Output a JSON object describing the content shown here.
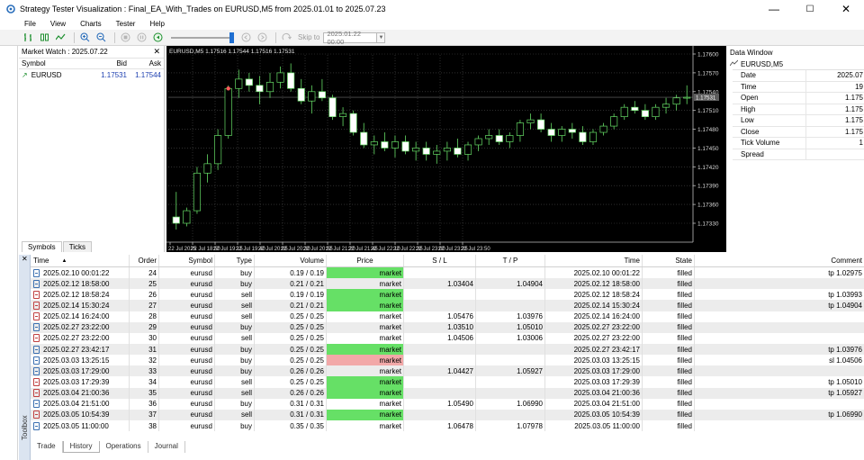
{
  "window": {
    "title": "Strategy Tester Visualization : Final_EA_With_Trades on EURUSD,M5 from 2025.01.01 to 2025.07.23",
    "minimize": "—",
    "maximize": "☐",
    "close": "✕"
  },
  "menu": [
    "File",
    "View",
    "Charts",
    "Tester",
    "Help"
  ],
  "toolbar": {
    "skip_label": "Skip to",
    "skip_date": "2025.01.22 00:00",
    "slider_position": 1.0
  },
  "market_watch": {
    "title": "Market Watch : 2025.07.22",
    "columns": [
      "Symbol",
      "Bid",
      "Ask"
    ],
    "rows": [
      {
        "symbol": "EURUSD",
        "bid": "1.17531",
        "ask": "1.17544"
      }
    ],
    "tabs": [
      "Symbols",
      "Ticks"
    ]
  },
  "chart": {
    "header": "EURUSD,M5  1.17516 1.17544 1.17516 1.17531",
    "price_labels": [
      "1.17600",
      "1.17570",
      "1.17540",
      "1.17510",
      "1.17480",
      "1.17450",
      "1.17420",
      "1.17390",
      "1.17360",
      "1.17330"
    ],
    "current_price_tag": "1.17531",
    "time_labels": [
      "22 Jul 2025",
      "22 Jul 18:50",
      "22 Jul 19:15",
      "22 Jul 19:40",
      "22 Jul 20:05",
      "22 Jul 20:30",
      "22 Jul 20:55",
      "22 Jul 21:20",
      "22 Jul 21:45",
      "22 Jul 22:10",
      "22 Jul 22:35",
      "22 Jul 23:00",
      "22 Jul 23:25",
      "22 Jul 23:50"
    ]
  },
  "data_window": {
    "title": "Data Window",
    "symbol": "EURUSD,M5",
    "rows": [
      {
        "label": "Date",
        "value": "2025.07"
      },
      {
        "label": "Time",
        "value": "19"
      },
      {
        "label": "Open",
        "value": "1.175"
      },
      {
        "label": "High",
        "value": "1.175"
      },
      {
        "label": "Low",
        "value": "1.175"
      },
      {
        "label": "Close",
        "value": "1.175"
      },
      {
        "label": "Tick Volume",
        "value": "1"
      },
      {
        "label": "Spread",
        "value": ""
      }
    ]
  },
  "toolbox": {
    "label": "Toolbox",
    "close": "✕"
  },
  "orders": {
    "columns": [
      "Time",
      "Order",
      "Symbol",
      "Type",
      "Volume",
      "Price",
      "S / L",
      "T / P",
      "Time",
      "State",
      "Comment"
    ],
    "sort_indicator": "▲",
    "rows": [
      {
        "time": "2025.02.10 00:01:22",
        "order": "24",
        "symbol": "eurusd",
        "type": "buy",
        "volume": "0.19 / 0.19",
        "price": "market",
        "price_bg": "green",
        "sl": "",
        "tp": "",
        "time2": "2025.02.10 00:01:22",
        "state": "filled",
        "comment": "tp 1.02975"
      },
      {
        "time": "2025.02.12 18:58:00",
        "order": "25",
        "symbol": "eurusd",
        "type": "buy",
        "volume": "0.21 / 0.21",
        "price": "market",
        "price_bg": "",
        "sl": "1.03404",
        "tp": "1.04904",
        "time2": "2025.02.12 18:58:00",
        "state": "filled",
        "comment": ""
      },
      {
        "time": "2025.02.12 18:58:24",
        "order": "26",
        "symbol": "eurusd",
        "type": "sell",
        "volume": "0.19 / 0.19",
        "price": "market",
        "price_bg": "green",
        "sl": "",
        "tp": "",
        "time2": "2025.02.12 18:58:24",
        "state": "filled",
        "comment": "tp 1.03993"
      },
      {
        "time": "2025.02.14 15:30:24",
        "order": "27",
        "symbol": "eurusd",
        "type": "sell",
        "volume": "0.21 / 0.21",
        "price": "market",
        "price_bg": "green",
        "sl": "",
        "tp": "",
        "time2": "2025.02.14 15:30:24",
        "state": "filled",
        "comment": "tp 1.04904"
      },
      {
        "time": "2025.02.14 16:24:00",
        "order": "28",
        "symbol": "eurusd",
        "type": "sell",
        "volume": "0.25 / 0.25",
        "price": "market",
        "price_bg": "",
        "sl": "1.05476",
        "tp": "1.03976",
        "time2": "2025.02.14 16:24:00",
        "state": "filled",
        "comment": ""
      },
      {
        "time": "2025.02.27 23:22:00",
        "order": "29",
        "symbol": "eurusd",
        "type": "buy",
        "volume": "0.25 / 0.25",
        "price": "market",
        "price_bg": "",
        "sl": "1.03510",
        "tp": "1.05010",
        "time2": "2025.02.27 23:22:00",
        "state": "filled",
        "comment": ""
      },
      {
        "time": "2025.02.27 23:22:00",
        "order": "30",
        "symbol": "eurusd",
        "type": "sell",
        "volume": "0.25 / 0.25",
        "price": "market",
        "price_bg": "",
        "sl": "1.04506",
        "tp": "1.03006",
        "time2": "2025.02.27 23:22:00",
        "state": "filled",
        "comment": ""
      },
      {
        "time": "2025.02.27 23:42:17",
        "order": "31",
        "symbol": "eurusd",
        "type": "buy",
        "volume": "0.25 / 0.25",
        "price": "market",
        "price_bg": "green",
        "sl": "",
        "tp": "",
        "time2": "2025.02.27 23:42:17",
        "state": "filled",
        "comment": "tp 1.03976"
      },
      {
        "time": "2025.03.03 13:25:15",
        "order": "32",
        "symbol": "eurusd",
        "type": "buy",
        "volume": "0.25 / 0.25",
        "price": "market",
        "price_bg": "red",
        "sl": "",
        "tp": "",
        "time2": "2025.03.03 13:25:15",
        "state": "filled",
        "comment": "sl 1.04506"
      },
      {
        "time": "2025.03.03 17:29:00",
        "order": "33",
        "symbol": "eurusd",
        "type": "buy",
        "volume": "0.26 / 0.26",
        "price": "market",
        "price_bg": "",
        "sl": "1.04427",
        "tp": "1.05927",
        "time2": "2025.03.03 17:29:00",
        "state": "filled",
        "comment": ""
      },
      {
        "time": "2025.03.03 17:29:39",
        "order": "34",
        "symbol": "eurusd",
        "type": "sell",
        "volume": "0.25 / 0.25",
        "price": "market",
        "price_bg": "green",
        "sl": "",
        "tp": "",
        "time2": "2025.03.03 17:29:39",
        "state": "filled",
        "comment": "tp 1.05010"
      },
      {
        "time": "2025.03.04 21:00:36",
        "order": "35",
        "symbol": "eurusd",
        "type": "sell",
        "volume": "0.26 / 0.26",
        "price": "market",
        "price_bg": "green",
        "sl": "",
        "tp": "",
        "time2": "2025.03.04 21:00:36",
        "state": "filled",
        "comment": "tp 1.05927"
      },
      {
        "time": "2025.03.04 21:51:00",
        "order": "36",
        "symbol": "eurusd",
        "type": "buy",
        "volume": "0.31 / 0.31",
        "price": "market",
        "price_bg": "",
        "sl": "1.05490",
        "tp": "1.06990",
        "time2": "2025.03.04 21:51:00",
        "state": "filled",
        "comment": ""
      },
      {
        "time": "2025.03.05 10:54:39",
        "order": "37",
        "symbol": "eurusd",
        "type": "sell",
        "volume": "0.31 / 0.31",
        "price": "market",
        "price_bg": "green",
        "sl": "",
        "tp": "",
        "time2": "2025.03.05 10:54:39",
        "state": "filled",
        "comment": "tp 1.06990"
      },
      {
        "time": "2025.03.05 11:00:00",
        "order": "38",
        "symbol": "eurusd",
        "type": "buy",
        "volume": "0.35 / 0.35",
        "price": "market",
        "price_bg": "",
        "sl": "1.06478",
        "tp": "1.07978",
        "time2": "2025.03.05 11:00:00",
        "state": "filled",
        "comment": ""
      }
    ]
  },
  "bottom_tabs": [
    "Trade",
    "History",
    "Operations",
    "Journal"
  ],
  "bottom_tabs_active": 1,
  "colors": {
    "price_green": "#66e066",
    "price_red": "#f2a8a8",
    "chart_bg": "#000000",
    "bull": "#ffffff",
    "bear": "#ffffff",
    "accent": "#1f6fd1"
  }
}
